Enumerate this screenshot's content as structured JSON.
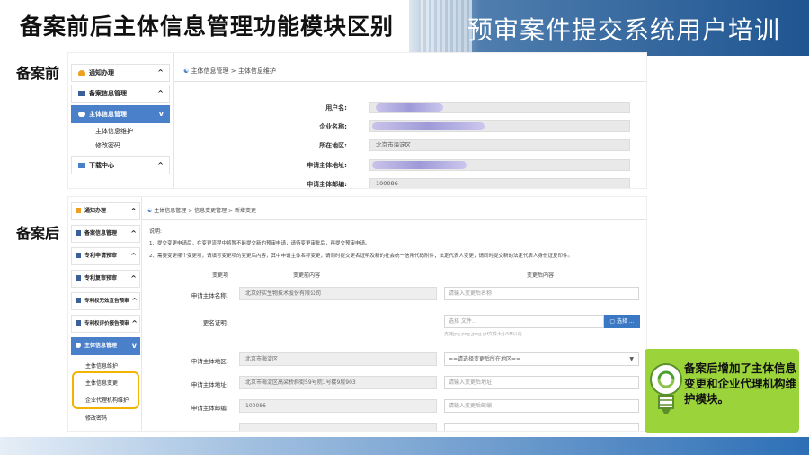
{
  "slide": {
    "title": "备案前后主体信息管理功能模块区别",
    "subtitle": "预审案件提交系统用户培训",
    "label_before": "备案前",
    "label_after": "备案后",
    "tip": "备案后增加了主体信息变更和企业代理机构维护模块。"
  },
  "colors": {
    "accent": "#4a7fca",
    "tip_bg": "#9bd33a",
    "highlight": "#f2b400",
    "header_blue": "#1f5590"
  },
  "before": {
    "sidebar": [
      {
        "label": "通知办理",
        "icon": "bell-icon",
        "caret": "^"
      },
      {
        "label": "备案信息管理",
        "icon": "folder-icon",
        "caret": "^"
      },
      {
        "label": "主体信息管理",
        "icon": "user-icon",
        "caret": "v",
        "active": true
      },
      {
        "label": "主体信息维护"
      },
      {
        "label": "修改密码"
      },
      {
        "label": "下载中心",
        "icon": "download-icon",
        "caret": "^"
      }
    ],
    "breadcrumb": "主体信息管理 > 主体信息维护",
    "fields": [
      {
        "label": "用户名:",
        "value": ""
      },
      {
        "label": "企业名称:",
        "value": ""
      },
      {
        "label": "所在地区:",
        "value": "北京市海淀区"
      },
      {
        "label": "申请主体地址:",
        "value": ""
      },
      {
        "label": "申请主体邮编:",
        "value": "100086"
      }
    ]
  },
  "after": {
    "sidebar": [
      {
        "label": "通知办理",
        "icon": "bell-icon",
        "caret": "^"
      },
      {
        "label": "备案信息管理",
        "icon": "folder-icon",
        "caret": "^"
      },
      {
        "label": "专利申请预审",
        "icon": "folder-icon",
        "caret": "^"
      },
      {
        "label": "专利复审预审",
        "icon": "folder-icon",
        "caret": "^"
      },
      {
        "label": "专利权无效宣告预审",
        "icon": "folder-icon",
        "caret": "^"
      },
      {
        "label": "专利权评价报告预审",
        "icon": "folder-icon",
        "caret": "^"
      },
      {
        "label": "主体信息管理",
        "icon": "user-icon",
        "caret": "v",
        "active": true
      },
      {
        "label": "主体信息维护"
      },
      {
        "label": "主体信息变更"
      },
      {
        "label": "企业代理机构维护"
      },
      {
        "label": "修改密码"
      }
    ],
    "breadcrumb": "主体信息管理 > 信息变更管理 > 新增变更",
    "notes": [
      "说明:",
      "1、提交变更申请后，在变更流程中将暂不能提交新的预审申请，请待变更审批后，再提交预审申请。",
      "2、需要变更哪个变更项，请填写变更项的变更后内容，其中申请主体名称变更，请同时提交更名证明及新的社会统一信用代码附件；法定代表人变更，请同时提交新的法定代表人身份证复印件。"
    ],
    "columns": [
      "变更项",
      "变更前内容",
      "变更后内容"
    ],
    "rows": [
      {
        "label": "申请主体名称:",
        "before": "北京好实生物技术股份有限公司",
        "after": "请输入变更后名称"
      },
      {
        "label": "更名证明:",
        "before": "",
        "after": "选择 文件...",
        "button": "选择 ...",
        "hint": "支持jpg,png,jpeg,gif文件大小5M以内"
      },
      {
        "label": "申请主体地区:",
        "before": "北京市海淀区",
        "after": "==请选择变更后所在地区=="
      },
      {
        "label": "申请主体地址:",
        "before": "北京市海淀区高梁桥斜街59号院1号楼9层903",
        "after": "请输入变更后地址"
      },
      {
        "label": "申请主体邮编:",
        "before": "100086",
        "after": "请输入变更后邮编"
      },
      {
        "label": "",
        "before": "",
        "after": ""
      }
    ]
  }
}
